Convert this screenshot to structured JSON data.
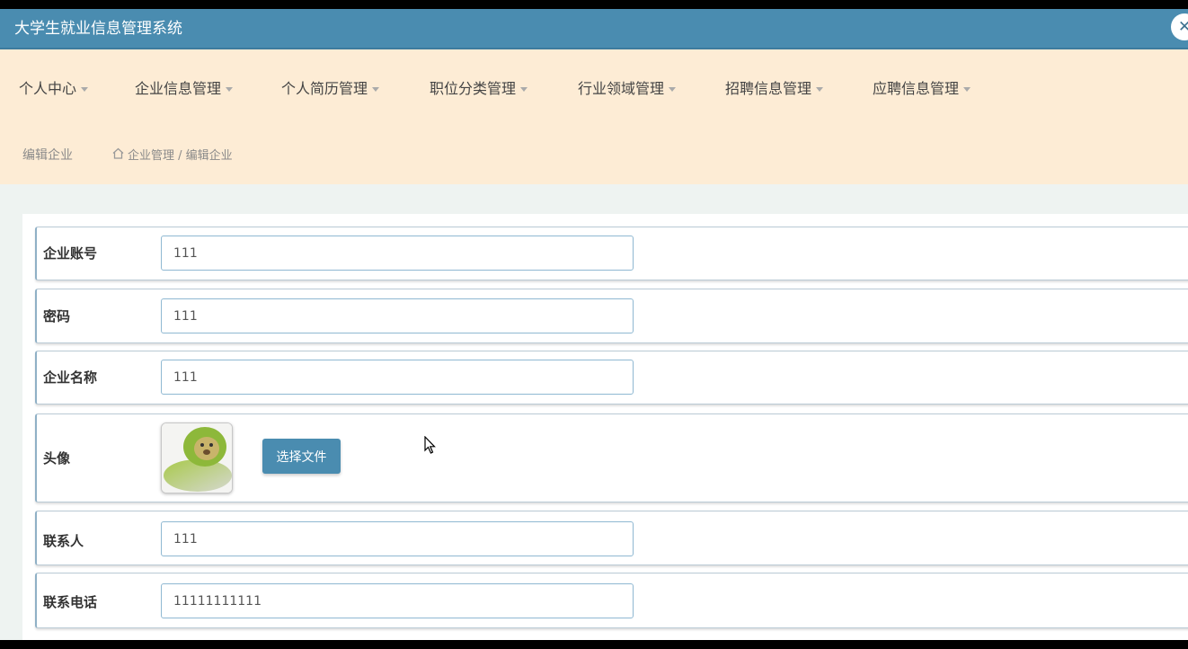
{
  "app": {
    "title": "大学生就业信息管理系统",
    "close_glyph": "✕"
  },
  "nav": {
    "items": [
      {
        "label": "个人中心"
      },
      {
        "label": "企业信息管理"
      },
      {
        "label": "个人简历管理"
      },
      {
        "label": "职位分类管理"
      },
      {
        "label": "行业领域管理"
      },
      {
        "label": "招聘信息管理"
      },
      {
        "label": "应聘信息管理"
      }
    ]
  },
  "breadcrumb": {
    "heading": "编辑企业",
    "path": "企业管理 / 编辑企业",
    "icon": "home-icon"
  },
  "form": {
    "fields": [
      {
        "label": "企业账号",
        "value": "111"
      },
      {
        "label": "密码",
        "value": "111"
      },
      {
        "label": "企业名称",
        "value": "111"
      },
      {
        "label": "头像",
        "button": "选择文件",
        "avatar": "avatar-image"
      },
      {
        "label": "联系人",
        "value": "111"
      },
      {
        "label": "联系电话",
        "value": "11111111111"
      }
    ]
  },
  "colors": {
    "titlebar": "#4a8cb0",
    "navbar": "#fdecd5",
    "accent": "#4a8cb0"
  }
}
